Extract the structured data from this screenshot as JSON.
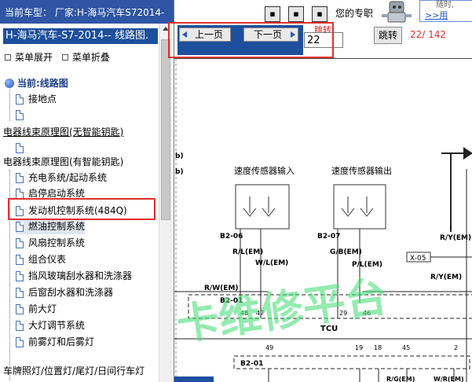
{
  "left": {
    "current_model_label": "当前车型： 厂家:H-海马汽车S72014-",
    "model_title": "H-海马汽车-S7-2014-- 线路图.",
    "menu_expand": "菜单展开",
    "menu_collapse": "菜单折叠",
    "tree": {
      "root": "当前:线路图",
      "items": [
        "接地点",
        "",
        "电器线束原理图(无智能钥匙)",
        "",
        "电器线束原理图(有智能钥匙)",
        "充电系统/起动系统",
        "启停启动系统",
        "发动机控制系统(484Q)",
        "燃油控制系统",
        "风扇控制系统",
        "组合仪表",
        "挡风玻璃刮水器和洗涤器",
        "后窗刮水器和洗涤器",
        "前大灯",
        "大灯调节系统",
        "前雾灯和后雾灯",
        "车牌照灯/位置灯/尾灯/日间行车灯"
      ]
    }
  },
  "toolbar": {
    "btn_a": "▪",
    "btn_b": "▪",
    "btn_c": "▪",
    "expert_text": "您的专职",
    "login_dim": "随时,",
    ">>login": ">>用"
  },
  "nav": {
    "prev_label": "上一页",
    "next_label": "下一页",
    "page_value": "22",
    "page_hint": "跳转",
    "jump_label": "跳转",
    "page_count": "22/ 142"
  },
  "diagram": {
    "b1": "b)",
    "b2": "b)",
    "sensor_in": "速度传感器输入",
    "sensor_out": "速度传感器输出",
    "c1": "B2-06",
    "c2": "B2-07",
    "w1": "R/L(EM)",
    "w2": "G/B(EM)",
    "w3": "W/L(EM)",
    "w4": "P/L(EM)",
    "w5": "R/W(EM)",
    "w6": "R/Y(EM)",
    "w7": "R/Y(EM)",
    "w8": "R/Y(E)",
    "x05": "X-05",
    "b201a": "B2-01",
    "b201b": "B2-01",
    "tcu": "TCU",
    "p48": "48",
    "p47": "47",
    "p29": "29",
    "p46": "46",
    "p49": "49",
    "p19": "19",
    "p18": "18",
    "p45": "45",
    "p2": "2",
    "bottom1": "R/G(EM)",
    "bottom2": "W/R(EM)",
    "watermark": "卡维修平台"
  },
  "colors": {
    "nav_blue": "#1d4f9c",
    "top_blue": "#2f55a4",
    "highlight_red": "#e03030",
    "watermark_green": "#4dde7a"
  }
}
